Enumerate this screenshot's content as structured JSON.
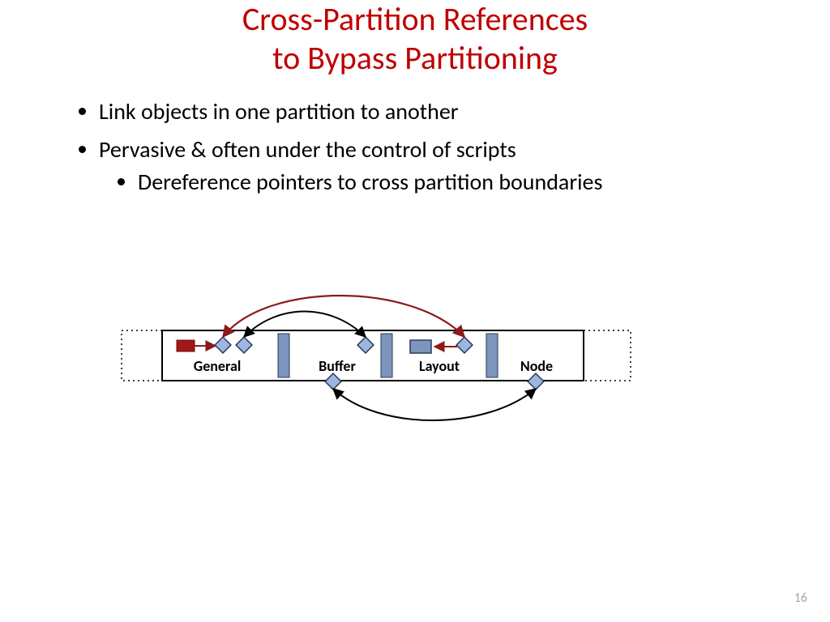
{
  "title_line1": "Cross-Partition References",
  "title_line2": "to Bypass Partitioning",
  "bullets": {
    "b1": "Link objects in one partition to another",
    "b2": "Pervasive & often under the control of scripts",
    "b2a": "Dereference pointers to cross partition boundaries"
  },
  "diagram": {
    "label_general": "General",
    "label_buffer": "Buffer",
    "label_layout": "Layout",
    "label_node": "Node"
  },
  "page_number": "16"
}
